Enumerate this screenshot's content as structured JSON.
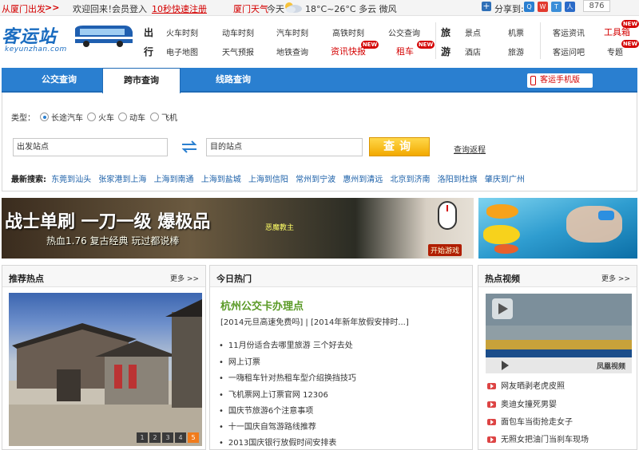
{
  "topbar": {
    "from_city": "从厦门出发",
    "arrows": ">>",
    "welcome": "欢迎回来！",
    "login": "会员登入",
    "register": "10秒快速注册",
    "weather_city": "厦门天气",
    "weather_day": "今天",
    "weather_detail": "18°C~26°C 多云 微风",
    "share_label": "分享到:",
    "share_count": "876"
  },
  "logo": {
    "text": "客运站",
    "sub": "keyunzhan.com"
  },
  "nav": {
    "group1_label_a": "出",
    "group1_label_b": "行",
    "group1_row1": [
      "火车时刻",
      "动车时刻",
      "汽车时刻",
      "高铁时刻",
      "公交查询"
    ],
    "group1_row2": [
      "电子地图",
      "天气预报",
      "地铁查询",
      "资讯快报",
      "租车"
    ],
    "group2_label_a": "旅",
    "group2_label_b": "游",
    "group2_row1": [
      "景点",
      "机票"
    ],
    "group2_row2": [
      "酒店",
      "旅游"
    ],
    "group3_row1": [
      "客运资讯",
      "工具箱"
    ],
    "group3_row2": [
      "客运问吧",
      "专题"
    ],
    "new_badge": "NEW"
  },
  "tabs": [
    "公交查询",
    "跨市查询",
    "线路查询"
  ],
  "mobile_label": "客运手机版",
  "search": {
    "type_label": "类型：",
    "options": [
      "长途汽车",
      "火车",
      "动车",
      "飞机"
    ],
    "from_value": "出发站点",
    "to_value": "目的站点",
    "button": "查询",
    "return_link": "查询返程",
    "recent_label": "最新搜索:",
    "recent": [
      "东莞到汕头",
      "张家港到上海",
      "上海到南通",
      "上海到盐城",
      "上海到信阳",
      "常州到宁波",
      "惠州到清远",
      "北京到济南",
      "洛阳到杜旗",
      "肇庆到广州"
    ]
  },
  "banner": {
    "title": "战士单刷 一刀一级 爆极品",
    "subtitle": "热血1.76 复古经典 玩过都说棒",
    "character": "恶魔教主",
    "start": "开始游戏"
  },
  "recommend": {
    "title": "推荐热点",
    "more": "更多 >>",
    "pages": [
      "1",
      "2",
      "3",
      "4",
      "5"
    ]
  },
  "today": {
    "title": "今日热门",
    "headline": "杭州公交卡办理点",
    "sub": "[2014元旦高速免费吗] | [2014年新年放假安排时...]",
    "items": [
      "11月份适合去哪里旅游 三个好去处",
      "网上订票",
      "一嗨租车针对热租车型介绍换挡技巧",
      "飞机票网上订票官网 12306",
      "国庆节旅游6个注意事项",
      "十一国庆自驾游路线推荐",
      "2013国庆银行放假时间安排表"
    ]
  },
  "video": {
    "title": "热点视频",
    "more": "更多 >>",
    "player_brand": "凤凰视频",
    "items": [
      "网友晒剥老虎皮照",
      "奥迪女撞死男婴",
      "面包车当街抢走女子",
      "无照女把油门当刹车现场"
    ]
  },
  "colors": {
    "brand_blue": "#2a7fd0",
    "alert_red": "#d40000",
    "headline_green": "#5a9a26",
    "button_orange": "#f2a900"
  }
}
